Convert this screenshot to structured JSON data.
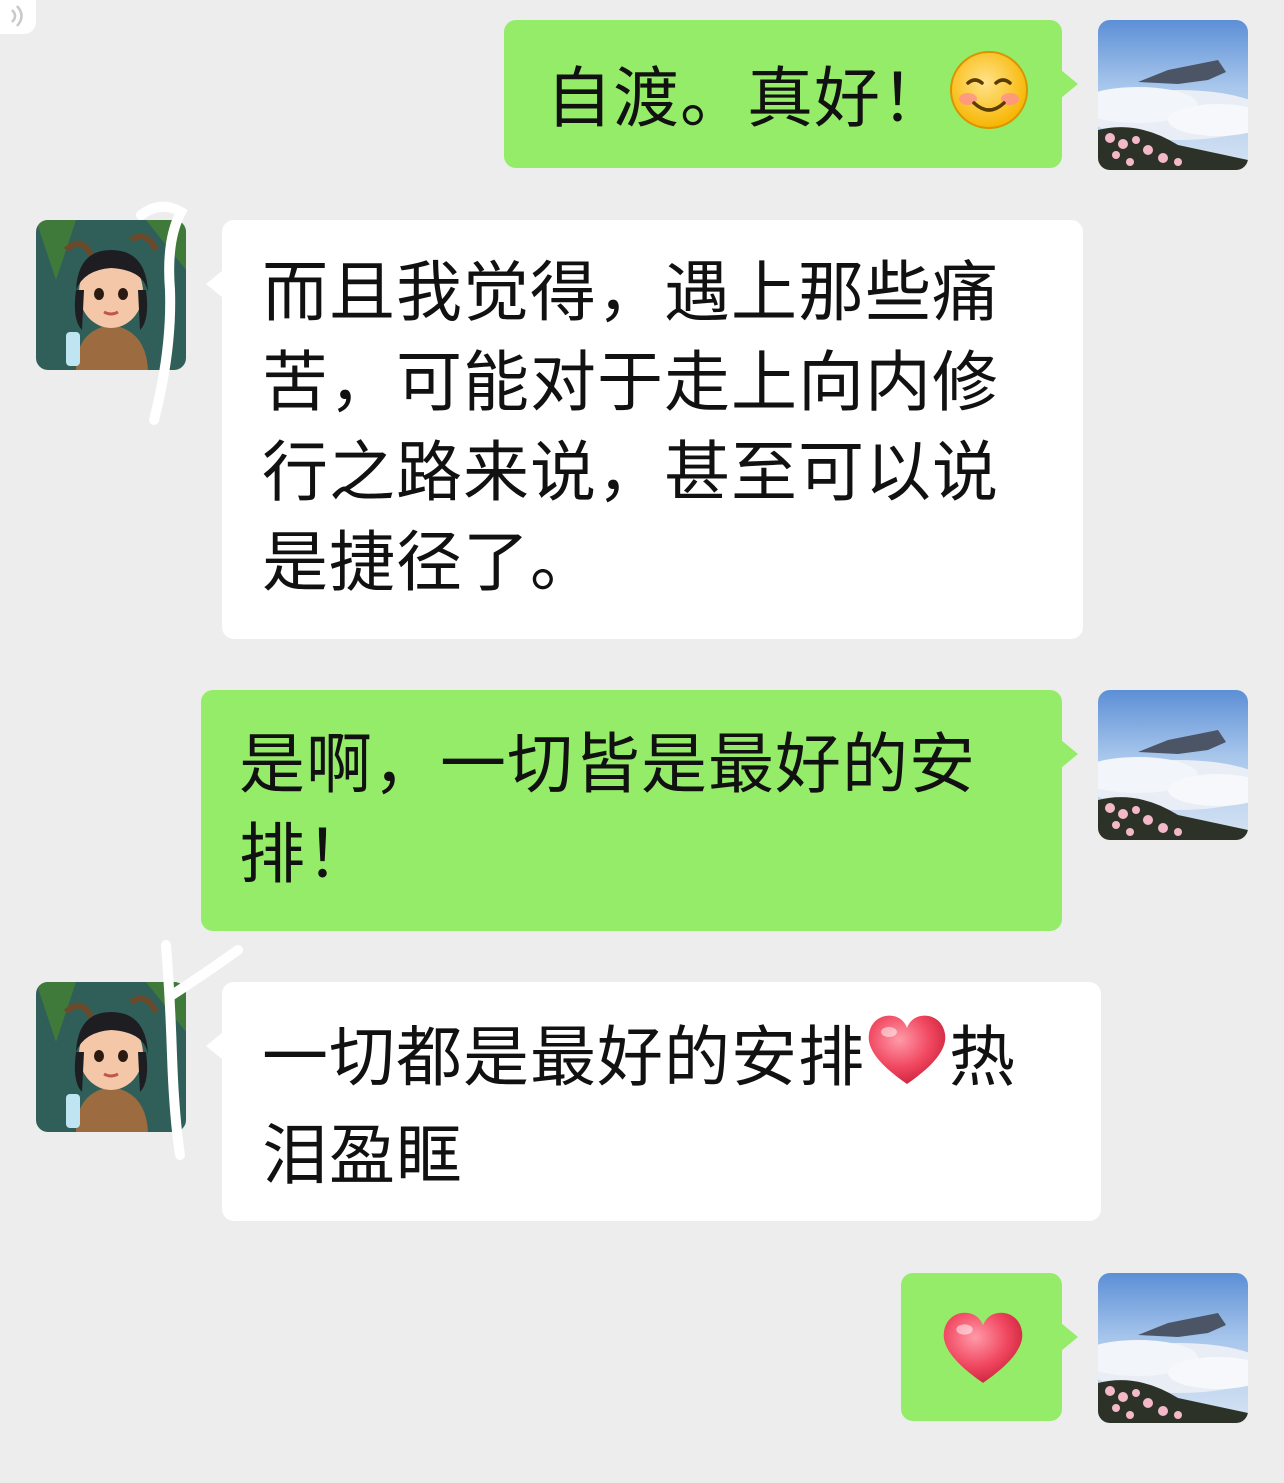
{
  "messages": [
    {
      "side": "out",
      "text": "自渡。真好！",
      "emoji": "smile-blush-emoji"
    },
    {
      "side": "in",
      "lines": [
        "而且我觉得，遇上那些痛",
        "苦，可能对于走上向内修",
        "行之路来说，甚至可以说",
        "是捷径了。"
      ]
    },
    {
      "side": "out",
      "lines": [
        "是啊，一切皆是最好的安",
        "排！"
      ]
    },
    {
      "side": "in",
      "line1": "一切都是最好的安排",
      "line1_after": "热",
      "line2": "泪盈眶",
      "emoji": "heart-emoji"
    },
    {
      "side": "out",
      "emoji": "heart-emoji"
    }
  ],
  "colors": {
    "background": "#ededed",
    "outgoing_bubble": "#95ec69",
    "incoming_bubble": "#ffffff",
    "text": "#111111"
  },
  "icons": [
    "voice-icon",
    "self-avatar-mountain",
    "friend-avatar-girl",
    "smile-blush-emoji",
    "heart-emoji"
  ]
}
